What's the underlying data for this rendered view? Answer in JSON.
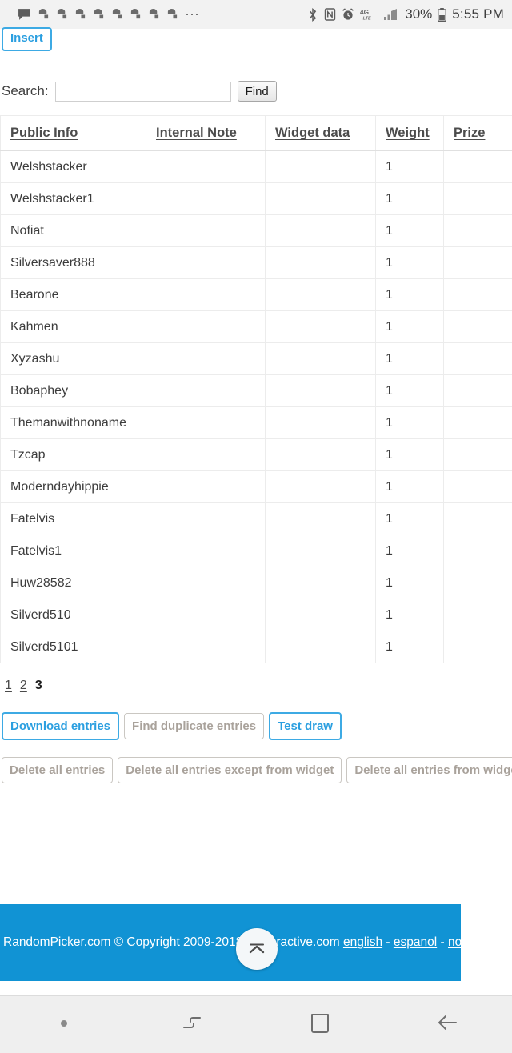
{
  "status_bar": {
    "notification_icons": [
      "message-icon",
      "app-icon",
      "app-icon",
      "app-icon",
      "app-icon",
      "app-icon",
      "app-icon",
      "app-icon",
      "app-icon"
    ],
    "overflow": "⋯",
    "bluetooth_icon": "bluetooth-icon",
    "nfc_icon": "nfc-icon",
    "alarm_icon": "alarm-icon",
    "network_label": "4G",
    "network_sublabel": "LTE",
    "signal_icon": "signal-bars-icon",
    "battery_percent": "30%",
    "battery_icon": "battery-icon",
    "time": "5:55 PM"
  },
  "toolbar": {
    "insert_label": "Insert"
  },
  "search": {
    "label": "Search:",
    "value": "",
    "placeholder": "",
    "find_label": "Find"
  },
  "table": {
    "columns": [
      "Public Info",
      "Internal Note",
      "Widget data",
      "Weight",
      "Prize",
      ""
    ],
    "rows": [
      {
        "public_info": "Welshstacker",
        "internal_note": "",
        "widget_data": "",
        "weight": "1",
        "prize": "",
        "extra": ""
      },
      {
        "public_info": "Welshstacker1",
        "internal_note": "",
        "widget_data": "",
        "weight": "1",
        "prize": "",
        "extra": ""
      },
      {
        "public_info": "Nofiat",
        "internal_note": "",
        "widget_data": "",
        "weight": "1",
        "prize": "",
        "extra": ""
      },
      {
        "public_info": "Silversaver888",
        "internal_note": "",
        "widget_data": "",
        "weight": "1",
        "prize": "",
        "extra": ""
      },
      {
        "public_info": "Bearone",
        "internal_note": "",
        "widget_data": "",
        "weight": "1",
        "prize": "",
        "extra": ""
      },
      {
        "public_info": "Kahmen",
        "internal_note": "",
        "widget_data": "",
        "weight": "1",
        "prize": "",
        "extra": ""
      },
      {
        "public_info": "Xyzashu",
        "internal_note": "",
        "widget_data": "",
        "weight": "1",
        "prize": "",
        "extra": ""
      },
      {
        "public_info": "Bobaphey",
        "internal_note": "",
        "widget_data": "",
        "weight": "1",
        "prize": "",
        "extra": ""
      },
      {
        "public_info": "Themanwithnoname",
        "internal_note": "",
        "widget_data": "",
        "weight": "1",
        "prize": "",
        "extra": ""
      },
      {
        "public_info": "Tzcap",
        "internal_note": "",
        "widget_data": "",
        "weight": "1",
        "prize": "",
        "extra": ""
      },
      {
        "public_info": "Moderndayhippie",
        "internal_note": "",
        "widget_data": "",
        "weight": "1",
        "prize": "",
        "extra": ""
      },
      {
        "public_info": "Fatelvis",
        "internal_note": "",
        "widget_data": "",
        "weight": "1",
        "prize": "",
        "extra": ""
      },
      {
        "public_info": "Fatelvis1",
        "internal_note": "",
        "widget_data": "",
        "weight": "1",
        "prize": "",
        "extra": ""
      },
      {
        "public_info": "Huw28582",
        "internal_note": "",
        "widget_data": "",
        "weight": "1",
        "prize": "",
        "extra": ""
      },
      {
        "public_info": "Silverd510",
        "internal_note": "",
        "widget_data": "",
        "weight": "1",
        "prize": "",
        "extra": ""
      },
      {
        "public_info": "Silverd5101",
        "internal_note": "",
        "widget_data": "",
        "weight": "1",
        "prize": "",
        "extra": ""
      }
    ]
  },
  "pagination": {
    "pages": [
      "1",
      "2",
      "3"
    ],
    "current": "3"
  },
  "actions_primary": [
    {
      "label": "Download entries",
      "style": "blue"
    },
    {
      "label": "Find duplicate entries",
      "style": "grey"
    },
    {
      "label": "Test draw",
      "style": "blue"
    }
  ],
  "actions_destructive": [
    {
      "label": "Delete all entries"
    },
    {
      "label": "Delete all entries except from widget"
    },
    {
      "label": "Delete all entries from widget"
    }
  ],
  "footer": {
    "copyright": "RandomPicker.com © Copyright 2009-2018, i-interactive.com",
    "lang_english": "english",
    "lang_espanol": "espanol",
    "lang_third": "norsk",
    "separator": "-",
    "background_color": "#1193d4",
    "scroll_top_icon": "chevron-double-up-icon"
  },
  "nav_bar": {
    "buttons": [
      {
        "name": "nav-dot",
        "icon": "dot-icon"
      },
      {
        "name": "nav-recents",
        "icon": "recent-apps-icon"
      },
      {
        "name": "nav-home",
        "icon": "home-square-icon"
      },
      {
        "name": "nav-back",
        "icon": "back-arrow-icon"
      }
    ]
  }
}
